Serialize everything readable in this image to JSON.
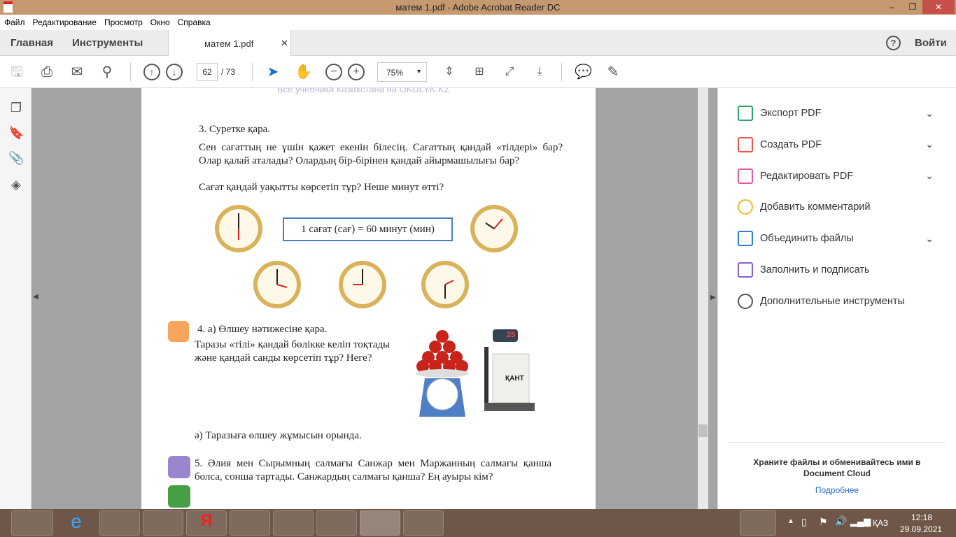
{
  "window": {
    "title": "матем 1.pdf - Adobe Acrobat Reader DC"
  },
  "menu": [
    "Файл",
    "Редактирование",
    "Просмотр",
    "Окно",
    "Справка"
  ],
  "tabs": {
    "home": "Главная",
    "tools": "Инструменты",
    "document": "матем 1.pdf",
    "signin": "Войти"
  },
  "toolbar": {
    "page_current": "62",
    "page_total": "/ 73",
    "zoom": "75%"
  },
  "page": {
    "watermark": "Все учебники Казахстана на OKULYK.KZ",
    "task3_title": "3. Суретке қара.",
    "task3_text": "Сен сағаттың не үшін қажет екенін білесің. Сағаттың қандай «тілдері» бар? Олар қалай аталады? Олардың бір-бірінен қандай айырмашылығы бар?",
    "task3_q": "Сағат қандай уақытты көрсетіп тұр? Неше минут өтті?",
    "box": "1 сағат (сағ) = 60 минут (мин)",
    "task4a": "4. а) Өлшеу нәтижесіне қара.",
    "task4b": "Таразы «тілі» қандай бөлікке келіп тоқтады және қандай санды көрсетіп тұр? Неге?",
    "scale_display": "25",
    "sack_label": "ҚАНТ",
    "task4c": "ә) Таразыға өлшеу жұмысын орында.",
    "task5": "5. Әлия мен Сырымның салмағы Санжар мен Маржанның салмағы қанша болса, сонша тартады. Санжардың салмағы қанша? Ең ауыры кім?"
  },
  "right_panel": {
    "items": [
      {
        "label": "Экспорт PDF",
        "icon": "export-pdf-icon",
        "color": "#2ea36b",
        "chevron": true
      },
      {
        "label": "Создать PDF",
        "icon": "create-pdf-icon",
        "color": "#e8574b",
        "chevron": true
      },
      {
        "label": "Редактировать PDF",
        "icon": "edit-pdf-icon",
        "color": "#e05aa0",
        "chevron": true
      },
      {
        "label": "Добавить комментарий",
        "icon": "comment-icon",
        "color": "#f5b82e",
        "chevron": false
      },
      {
        "label": "Объединить файлы",
        "icon": "combine-icon",
        "color": "#2d7fd3",
        "chevron": true
      },
      {
        "label": "Заполнить и подписать",
        "icon": "sign-icon",
        "color": "#8a5fd1",
        "chevron": false
      },
      {
        "label": "Дополнительные инструменты",
        "icon": "plus-circle-icon",
        "color": "#555555",
        "chevron": false
      }
    ],
    "cloud_text": "Храните файлы и обменивайтесь ими в Document Cloud",
    "cloud_link": "Подробнее"
  },
  "taskbar": {
    "lang": "ҚАЗ",
    "time": "12:18",
    "date": "29.09.2021"
  }
}
